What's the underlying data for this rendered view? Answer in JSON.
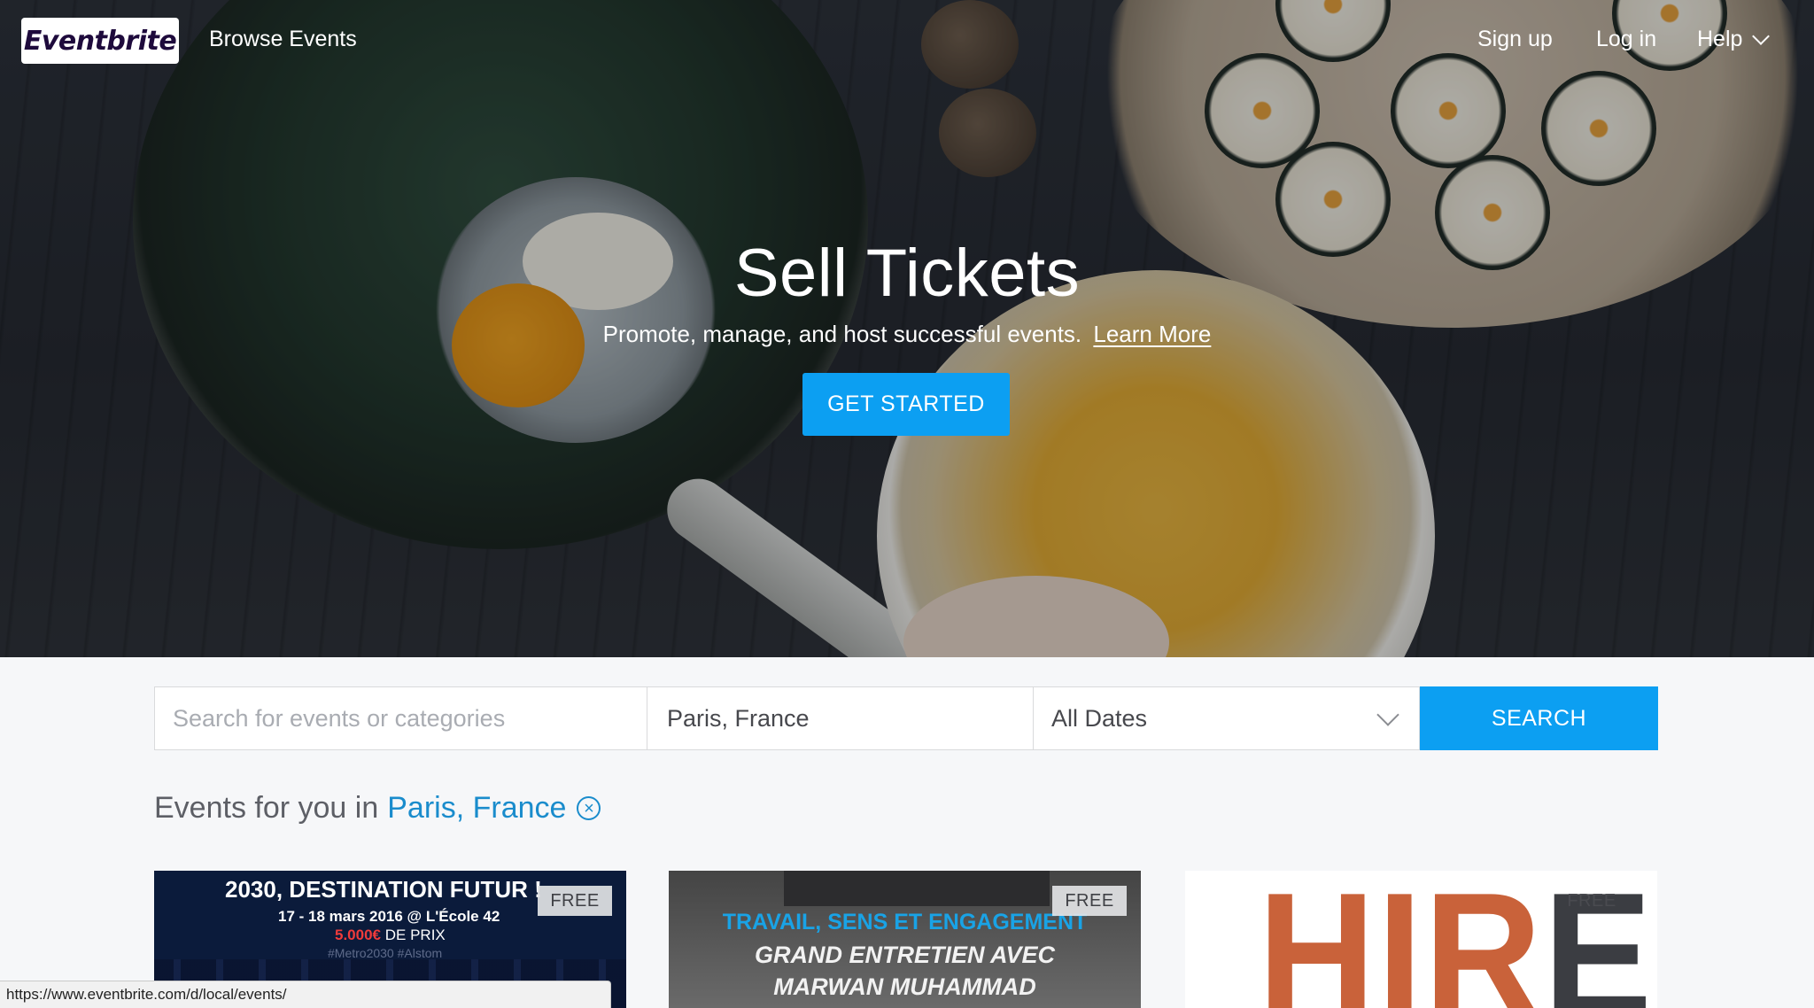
{
  "nav": {
    "logo": "Eventbrite",
    "browse": "Browse Events",
    "signup": "Sign up",
    "login": "Log in",
    "help": "Help"
  },
  "hero": {
    "title": "Sell Tickets",
    "subtitle": "Promote, manage, and host successful events.",
    "learn_more": "Learn More",
    "cta": "GET STARTED"
  },
  "search": {
    "placeholder": "Search for events or categories",
    "location": "Paris, France",
    "date": "All Dates",
    "button": "SEARCH"
  },
  "events": {
    "heading": "Events for you in",
    "location": "Paris, France"
  },
  "cards": [
    {
      "badge": "FREE",
      "title": "2030, DESTINATION FUTUR !",
      "date": "17 - 18 mars 2016 @ L'École 42",
      "prize_amount": "5.000€",
      "prize_text": "DE PRIX",
      "tags": "#Metro2030  #Alstom"
    },
    {
      "badge": "FREE",
      "line1": "TRAVAIL, SENS ET ENGAGEMENT",
      "line2": "GRAND ENTRETIEN AVEC",
      "line3": "MARWAN MUHAMMAD"
    },
    {
      "badge": "FREE",
      "word_accent": "HIR",
      "word_dark": "E."
    }
  ],
  "status_url": "https://www.eventbrite.com/d/local/events/",
  "colors": {
    "accent": "#0c9ff2",
    "link": "#1a8ccc",
    "hire_orange": "#c9623a"
  }
}
